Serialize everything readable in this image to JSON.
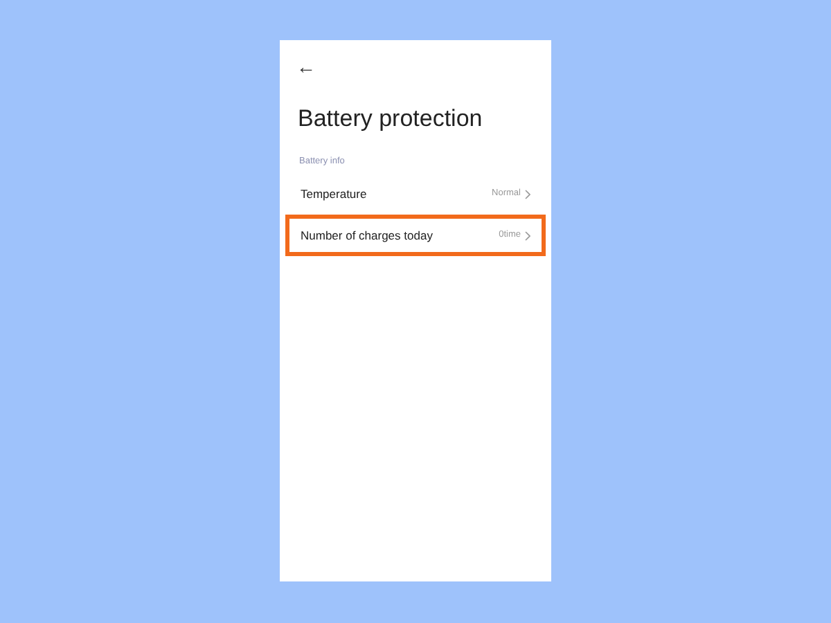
{
  "header": {
    "back": "←",
    "title": "Battery protection"
  },
  "section": {
    "label": "Battery info"
  },
  "rows": [
    {
      "label": "Temperature",
      "value": "Normal",
      "highlighted": false
    },
    {
      "label": "Number of charges today",
      "value": "0time",
      "highlighted": true
    }
  ]
}
